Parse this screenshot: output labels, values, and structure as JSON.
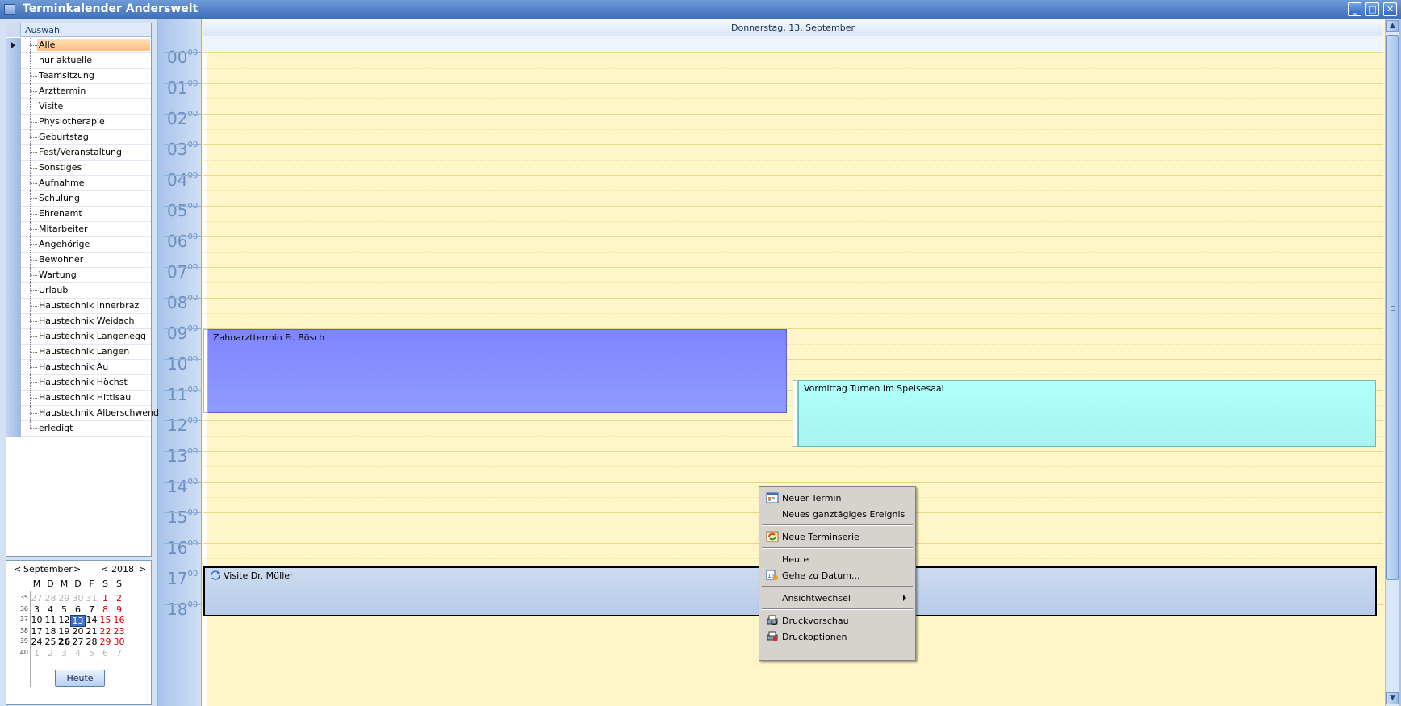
{
  "window": {
    "title": "Terminkalender Anderswelt",
    "buttons": {
      "minimize": "_",
      "maximize": "□",
      "close": "✕"
    }
  },
  "tree": {
    "header": "Auswahl",
    "items": [
      "Alle",
      "nur aktuelle",
      "Teamsitzung",
      "Arzttermin",
      "Visite",
      "Physiotherapie",
      "Geburtstag",
      "Fest/Veranstaltung",
      "Sonstiges",
      "Aufnahme",
      "Schulung",
      "Ehrenamt",
      "Mitarbeiter",
      "Angehörige",
      "Bewohner",
      "Wartung",
      "Urlaub",
      "Haustechnik Innerbraz",
      "Haustechnik Weidach",
      "Haustechnik Langenegg",
      "Haustechnik Langen",
      "Haustechnik Au",
      "Haustechnik Höchst",
      "Haustechnik Hittisau",
      "Haustechnik Alberschwende",
      "erledigt"
    ],
    "selected": "Alle"
  },
  "minical": {
    "month": "September",
    "year": "2018",
    "prev": "<",
    "next": ">",
    "dow": [
      "M",
      "D",
      "M",
      "D",
      "F",
      "S",
      "S"
    ],
    "weeks": [
      "35",
      "36",
      "37",
      "38",
      "39",
      "40"
    ],
    "rows": [
      [
        "27",
        "28",
        "29",
        "30",
        "31",
        "1",
        "2"
      ],
      [
        "3",
        "4",
        "5",
        "6",
        "7",
        "8",
        "9"
      ],
      [
        "10",
        "11",
        "12",
        "13",
        "14",
        "15",
        "16"
      ],
      [
        "17",
        "18",
        "19",
        "20",
        "21",
        "22",
        "23"
      ],
      [
        "24",
        "25",
        "26",
        "27",
        "28",
        "29",
        "30"
      ],
      [
        "1",
        "2",
        "3",
        "4",
        "5",
        "6",
        "7"
      ]
    ],
    "today_button": "Heute"
  },
  "calendar": {
    "date_header": "Donnerstag, 13. September",
    "hours": [
      "00",
      "01",
      "02",
      "03",
      "04",
      "05",
      "06",
      "07",
      "08",
      "09",
      "10",
      "11",
      "12",
      "13",
      "14",
      "15",
      "16",
      "17",
      "18"
    ],
    "minutes_label": "00",
    "events": [
      {
        "title": "Zahnarzttermin Fr. Bösch",
        "color": "#8088ff"
      },
      {
        "title": "Vormittag Turnen im Speisesaal",
        "color": "#aaf8f6"
      },
      {
        "title": "Visite Dr. Müller",
        "color": "#c2d4ee"
      }
    ]
  },
  "context_menu": {
    "items": [
      {
        "label": "Neuer Termin",
        "icon": "calendar-icon"
      },
      {
        "label": "Neues ganztägiges Ereignis",
        "icon": ""
      },
      {
        "label": "Neue Terminserie",
        "icon": "recurrence-icon"
      },
      {
        "label": "Heute",
        "icon": ""
      },
      {
        "label": "Gehe zu Datum...",
        "icon": "goto-date-icon"
      },
      {
        "label": "Ansichtwechsel",
        "icon": ""
      },
      {
        "label": "Druckvorschau",
        "icon": "print-preview-icon"
      },
      {
        "label": "Druckoptionen",
        "icon": "print-options-icon"
      }
    ]
  },
  "colors": {
    "accent": "#3e70c6",
    "grid_bg": "#fff6c8",
    "selection": "#ffbe82"
  }
}
